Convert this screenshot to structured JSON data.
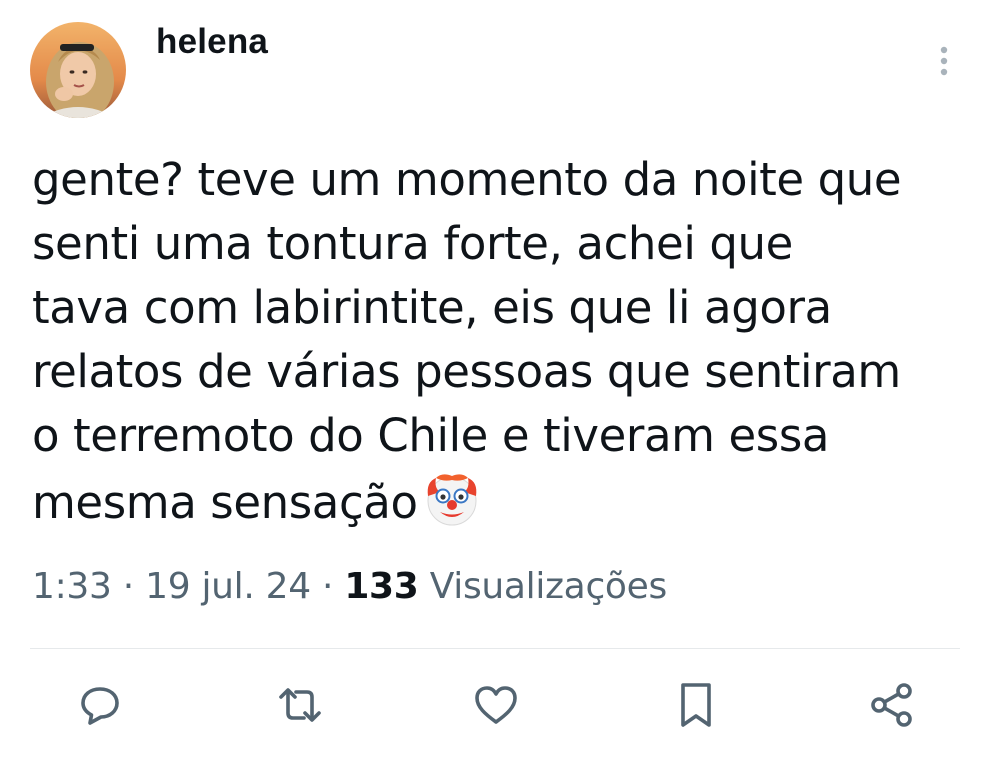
{
  "user": {
    "name": "helena"
  },
  "tweet": {
    "text": "gente? teve um momento da noite que\nsenti uma tontura forte, achei que\ntava com labirintite, eis que li agora\nrelatos de várias pessoas que sentiram\no terremoto do Chile e tiveram essa\nmesma sensação",
    "emoji": "clown-face"
  },
  "meta": {
    "time": "1:33",
    "separator": " · ",
    "date": "19 jul. 24",
    "views_count": "133",
    "views_label": " Visualizações"
  },
  "actions": [
    {
      "icon": "reply-icon"
    },
    {
      "icon": "retweet-icon"
    },
    {
      "icon": "like-icon"
    },
    {
      "icon": "bookmark-icon"
    },
    {
      "icon": "share-icon"
    }
  ],
  "colors": {
    "text": "#0f1419",
    "secondary": "#536471",
    "divider": "#e6e9eb"
  }
}
